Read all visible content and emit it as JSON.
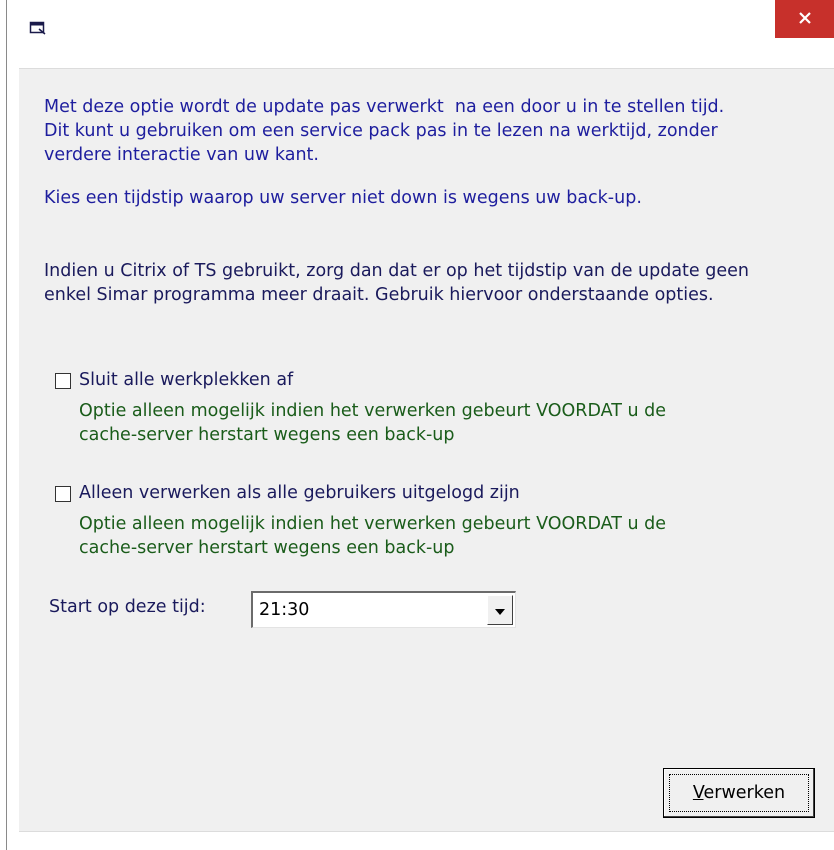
{
  "window": {
    "title": ""
  },
  "intro": {
    "line1": "Met deze optie wordt de update pas verwerkt  na een door u in te stellen tijd.",
    "line2": "Dit kunt u gebruiken om een service pack pas in te lezen na werktijd, zonder",
    "line3": "verdere interactie van uw kant."
  },
  "choose_time": "Kies een tijdstip waarop uw server niet down is wegens uw back-up.",
  "citrix": {
    "line1": "Indien u Citrix of TS gebruikt, zorg dan dat er op het tijdstip van de update geen",
    "line2": "enkel Simar programma meer draait. Gebruik hiervoor onderstaande opties."
  },
  "options": [
    {
      "label": "Sluit alle werkplekken af",
      "checked": false,
      "note_line1": "Optie alleen mogelijk indien het verwerken gebeurt VOORDAT u de",
      "note_line2": "cache-server herstart wegens een back-up"
    },
    {
      "label": "Alleen verwerken als alle gebruikers uitgelogd zijn",
      "checked": false,
      "note_line1": "Optie alleen mogelijk indien het verwerken gebeurt VOORDAT u de",
      "note_line2": "cache-server herstart wegens een back-up"
    }
  ],
  "start_time": {
    "label": "Start op deze tijd:",
    "value": "21:30"
  },
  "process_button": {
    "accel": "V",
    "rest": "erwerken"
  },
  "icons": {
    "app": "window-icon",
    "close": "close-icon",
    "dropdown": "dropdown-arrow-icon"
  },
  "colors": {
    "close_bg": "#c7302b",
    "info_text": "#1e1e9e",
    "note_text": "#1a5c1a",
    "dialog_bg": "#f0f0f0"
  }
}
